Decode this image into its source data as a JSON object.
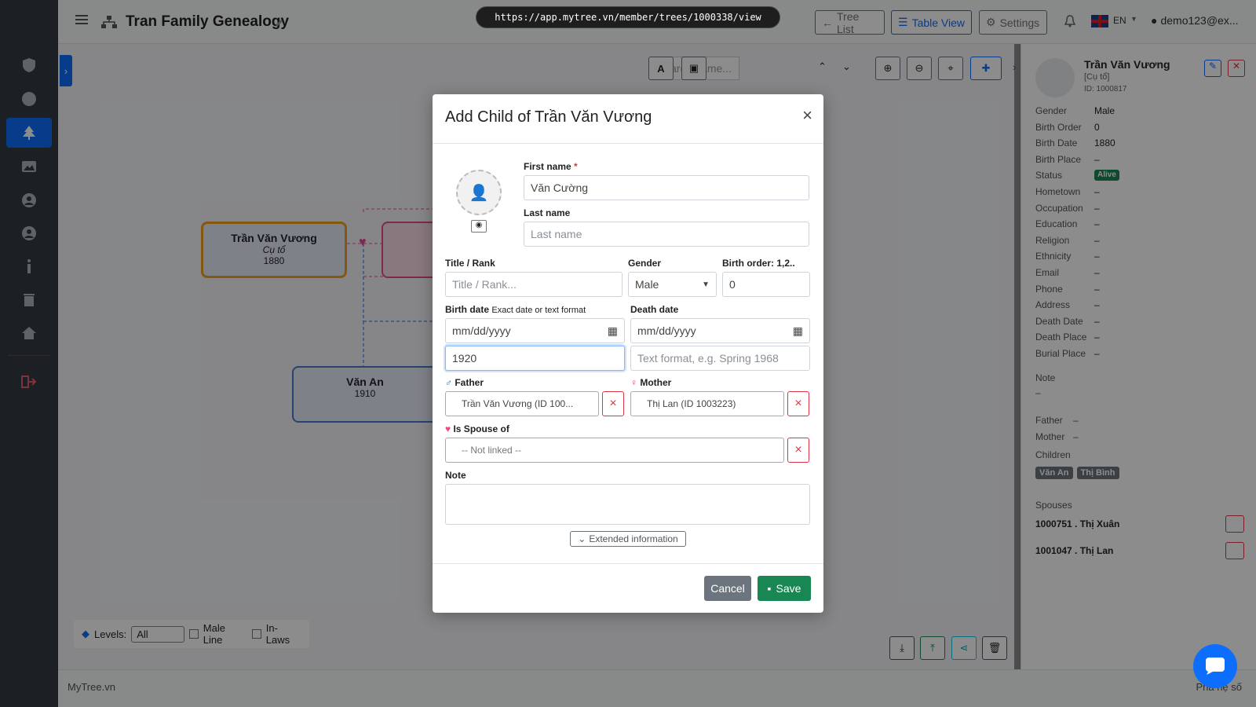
{
  "app": {
    "title": "Tran Family Genealogy",
    "url": "https://app.mytree.vn/member/trees/1000338/view",
    "user": "demo123@ex...",
    "lang": "EN",
    "footer_left": "MyTree.vn",
    "footer_right": "Phả hệ số"
  },
  "topbar": {
    "tree_list": "Tree List",
    "table_view": "Table View",
    "settings": "Settings"
  },
  "canvas": {
    "search_placeholder": "Search name...",
    "levels_label": "Levels:",
    "levels_value": "All",
    "male_line": "Male Line",
    "in_laws": "In-Laws",
    "cards": [
      {
        "name": "Trần Văn Vương",
        "title": "Cụ tổ",
        "year": "1880"
      },
      {
        "name": "Văn An",
        "year": "1910"
      }
    ]
  },
  "panel": {
    "name": "Trần Văn Vương",
    "title": "[Cụ tổ]",
    "id": "ID: 1000817",
    "fields": [
      {
        "k": "Gender",
        "v": "Male"
      },
      {
        "k": "Birth Order",
        "v": "0"
      },
      {
        "k": "Birth Date",
        "v": "1880"
      },
      {
        "k": "Birth Place",
        "v": "–"
      },
      {
        "k": "Status",
        "v": "Alive"
      },
      {
        "k": "Hometown",
        "v": "–"
      },
      {
        "k": "Occupation",
        "v": "–"
      },
      {
        "k": "Education",
        "v": "–"
      },
      {
        "k": "Religion",
        "v": "–"
      },
      {
        "k": "Ethnicity",
        "v": "–"
      },
      {
        "k": "Email",
        "v": "–"
      },
      {
        "k": "Phone",
        "v": "–"
      },
      {
        "k": "Address",
        "v": "–"
      },
      {
        "k": "Death Date",
        "v": "–"
      },
      {
        "k": "Death Place",
        "v": "–"
      },
      {
        "k": "Burial Place",
        "v": "–"
      }
    ],
    "note_label": "Note",
    "note_value": "–",
    "father_label": "Father",
    "father_value": "–",
    "mother_label": "Mother",
    "mother_value": "–",
    "children_label": "Children",
    "children": [
      "Văn An",
      "Thị Bình"
    ],
    "spouses_label": "Spouses",
    "spouses": [
      "1000751 . Thị Xuân",
      "1001047 . Thị Lan"
    ]
  },
  "modal": {
    "title": "Add Child of Trần Văn Vương",
    "first_name_label": "First name",
    "required_mark": "*",
    "first_name_value": "Văn Cường",
    "last_name_label": "Last name",
    "last_name_placeholder": "Last name",
    "title_label": "Title / Rank",
    "title_placeholder": "Title / Rank...",
    "gender_label": "Gender",
    "gender_value": "Male",
    "birth_order_label": "Birth order: 1,2..",
    "birth_order_value": "0",
    "birth_date_label": "Birth date",
    "birth_date_hint": "Exact date or text format",
    "death_date_label": "Death date",
    "date_placeholder": "mm/dd/yyyy",
    "birth_text_value": "1920",
    "death_text_placeholder": "Text format, e.g. Spring 1968",
    "father_label": "Father",
    "father_value": "Trần Văn Vương (ID 100...",
    "mother_label": "Mother",
    "mother_value": "Thị Lan (ID 1003223)",
    "spouse_label": "Is Spouse of",
    "spouse_value": "-- Not linked --",
    "note_label": "Note",
    "extended": "Extended information",
    "cancel": "Cancel",
    "save": "Save"
  }
}
